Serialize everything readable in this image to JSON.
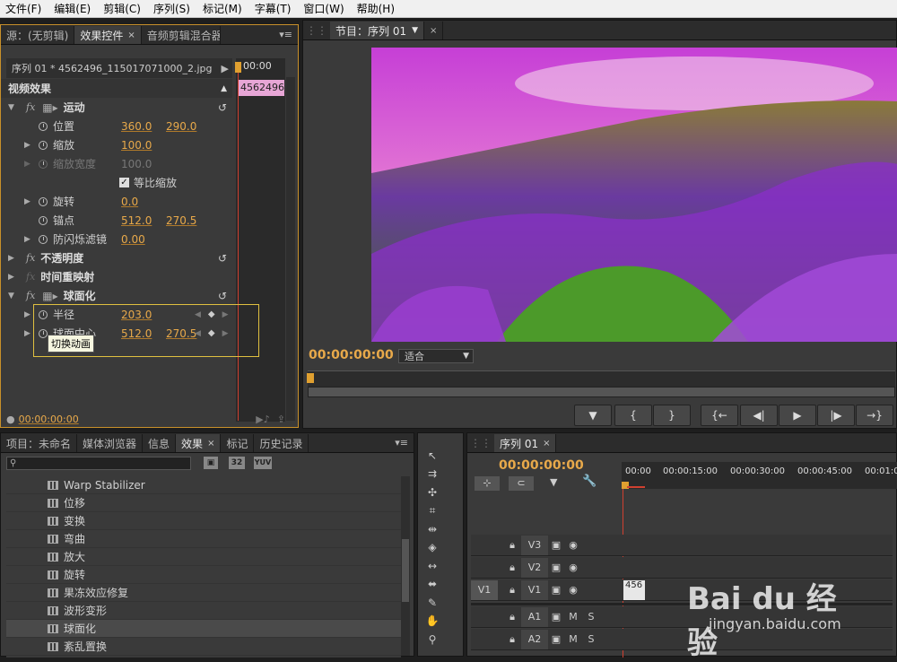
{
  "menu": [
    "文件(F)",
    "编辑(E)",
    "剪辑(C)",
    "序列(S)",
    "标记(M)",
    "字幕(T)",
    "窗口(W)",
    "帮助(H)"
  ],
  "effect_panel": {
    "tabs": [
      {
        "label": "源：(无剪辑)"
      },
      {
        "label": "效果控件"
      },
      {
        "label": "音频剪辑混合器"
      }
    ],
    "clip_header": "序列 01 * 4562496_115017071000_2.jpg",
    "timecode_top": "00:00",
    "clip_chip": "4562496_",
    "section": "视频效果",
    "rows": {
      "motion": "运动",
      "position": "位置",
      "position_x": "360.0",
      "position_y": "290.0",
      "scale": "缩放",
      "scale_v": "100.0",
      "scale_width": "缩放宽度",
      "scale_width_v": "100.0",
      "uniform": "等比缩放",
      "rotation": "旋转",
      "rotation_v": "0.0",
      "anchor": "锚点",
      "anchor_x": "512.0",
      "anchor_y": "270.5",
      "antiflicker": "防闪烁滤镜",
      "antiflicker_v": "0.00",
      "opacity": "不透明度",
      "timeremap": "时间重映射",
      "spherize": "球面化",
      "radius": "半径",
      "radius_v": "203.0",
      "center": "球面中心",
      "center_x": "512.0",
      "center_y": "270.5",
      "tooltip": "切换动画"
    },
    "footer_time": "00:00:00:00"
  },
  "program": {
    "tab": "节目：序列 01",
    "timecode": "00:00:00:00",
    "fit": "适合"
  },
  "transport": [
    "▼",
    "{",
    "}",
    "{←",
    "◀|",
    "▶",
    "|▶",
    "→}"
  ],
  "effects_panel": {
    "tabs": [
      {
        "label": "项目：未命名"
      },
      {
        "label": "媒体浏览器"
      },
      {
        "label": "信息"
      },
      {
        "label": "效果"
      },
      {
        "label": "标记"
      },
      {
        "label": "历史记录"
      }
    ],
    "badges": [
      "32",
      "YUV"
    ],
    "items": [
      "Warp Stabilizer",
      "位移",
      "变换",
      "弯曲",
      "放大",
      "旋转",
      "果冻效应修复",
      "波形变形",
      "球面化",
      "紊乱置换"
    ]
  },
  "timeline": {
    "tab": "序列 01",
    "timecode": "00:00:00:00",
    "ruler": [
      "00:00",
      "00:00:15:00",
      "00:00:30:00",
      "00:00:45:00",
      "00:01:0"
    ],
    "tracks": [
      {
        "name": "V3",
        "source": ""
      },
      {
        "name": "V2",
        "source": ""
      },
      {
        "name": "V1",
        "source": "V1"
      },
      {
        "name": "A1",
        "source": ""
      },
      {
        "name": "A2",
        "source": ""
      }
    ],
    "clip": "456",
    "audio_m": "M",
    "audio_s": "S"
  },
  "watermark": {
    "brand": "Bai du 经验",
    "url": "jingyan.baidu.com"
  }
}
